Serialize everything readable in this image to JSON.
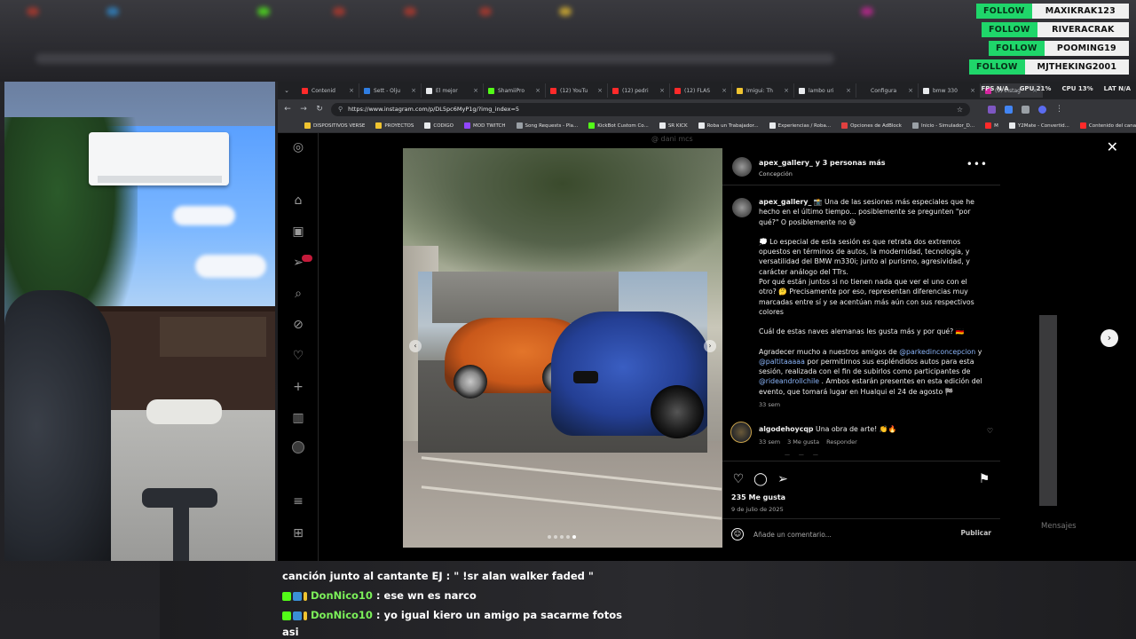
{
  "follows": [
    {
      "tag": "FOLLOW",
      "name": "MAXIKRAK123"
    },
    {
      "tag": "FOLLOW",
      "name": "RIVERACRAK"
    },
    {
      "tag": "FOLLOW",
      "name": "POOMING19"
    },
    {
      "tag": "FOLLOW",
      "name": "MJTHEKING2001"
    }
  ],
  "browser": {
    "tabs": [
      {
        "label": "Contenid",
        "color": "#ff2a2a"
      },
      {
        "label": "Sett - Olju",
        "color": "#2f7de1"
      },
      {
        "label": "El mejor",
        "color": "#e8eaed"
      },
      {
        "label": "ShamiiPro",
        "color": "#53fc18"
      },
      {
        "label": "(12) YouTu",
        "color": "#ff2a2a"
      },
      {
        "label": "(12) pedri",
        "color": "#ff2a2a"
      },
      {
        "label": "(12) FLAS",
        "color": "#ff2a2a"
      },
      {
        "label": "Imigui: Th",
        "color": "#f0c430"
      },
      {
        "label": "lambo uri",
        "color": "#e8eaed"
      },
      {
        "label": "Configura",
        "color": "#202124"
      },
      {
        "label": "bmw 330",
        "color": "#e8eaed"
      },
      {
        "label": "(9) Instag",
        "color": "#d6249f"
      }
    ],
    "stats": [
      "FPS N/A",
      "GPU 21%",
      "CPU 13%",
      "LAT N/A"
    ],
    "url": "https://www.instagram.com/p/DL5pc6MyP1g/?img_index=5",
    "bookmarks": [
      {
        "label": "DISPOSITIVOS VERSE",
        "color": "#f0c430"
      },
      {
        "label": "PROYECTOS",
        "color": "#f0c430"
      },
      {
        "label": "CODIGO",
        "color": "#e8eaed"
      },
      {
        "label": "MOD TWITCH",
        "color": "#9146ff"
      },
      {
        "label": "Song Requests - Pla...",
        "color": "#9aa0a6"
      },
      {
        "label": "KickBot Custom Co...",
        "color": "#53fc18"
      },
      {
        "label": "SR KICK",
        "color": "#e8eaed"
      },
      {
        "label": "Roba un Trabajador...",
        "color": "#e8eaed"
      },
      {
        "label": "Experiencias / Roba...",
        "color": "#e8eaed"
      },
      {
        "label": "Opciones de AdBlock",
        "color": "#e04040"
      },
      {
        "label": "Inicio - Simulador_D...",
        "color": "#9aa0a6"
      },
      {
        "label": "M",
        "color": "#ff2a2a"
      },
      {
        "label": "Y2Mate - Convertid...",
        "color": "#e8eaed"
      },
      {
        "label": "Contenido del canal...",
        "color": "#ff2a2a"
      }
    ]
  },
  "instagram": {
    "faded_username": "@ dani mcs",
    "post_header_user": "apex_gallery_",
    "post_header_rest": " y 3 personas más",
    "location": "Concepción",
    "caption_user": "apex_gallery_",
    "caption_p1": " 📸 Una de las sesiones más especiales que he hecho en el último tiempo... posiblemente se pregunten \"por qué?\" O posiblemente no 😅",
    "caption_p2": "💭 Lo especial de esta sesión es que retrata dos extremos opuestos en términos de autos, la modernidad, tecnología, y versatilidad del BMW m330i; junto al purismo, agresividad, y carácter análogo del TTrs.",
    "caption_p3": "Por qué están juntos si no tienen nada que ver el uno con el otro? 🤔 Precisamente por eso, representan diferencias muy marcadas entre sí y se acentúan más aún con sus respectivos colores",
    "caption_p4": "Cuál de estas naves alemanas les gusta más y por qué? 🇩🇪",
    "caption_p5a": "Agradecer mucho a nuestros amigos de ",
    "mention1": "@parkedinconcepcion",
    "caption_p5b": " y ",
    "mention2": "@paltitaaaaa",
    "caption_p5c": " por permitirnos sus espléndidos autos para esta sesión, realizada con el fin de subirlos como participantes de ",
    "mention3": "@rideandrollchile",
    "caption_p5d": " . Ambos estarán presentes en esta edición del evento, que tomará lugar en Hualqui el 24 de agosto 🏁",
    "caption_time": "33 sem",
    "comment_user": "algodehoycqp",
    "comment_text": " Una obra de arte! 👏🔥",
    "comment_time": "33 sem",
    "comment_likes": "3 Me gusta",
    "comment_reply": "Responder",
    "likes": "235 Me gusta",
    "date": "9 de julio de 2025",
    "comment_placeholder": "Añade un comentario...",
    "publish": "Publicar",
    "mensajes": "Mensajes",
    "carousel_active_index": 4,
    "carousel_count": 5
  },
  "chat": [
    {
      "user": "",
      "text": "canción junto al cantante EJ : \" !sr alan walker faded \""
    },
    {
      "user": "DonNico10",
      "text": " : ese wn es narco"
    },
    {
      "user": "DonNico10",
      "text": " : yo igual kiero un amigo pa sacarme fotos"
    },
    {
      "user": "",
      "text": "asi"
    }
  ]
}
